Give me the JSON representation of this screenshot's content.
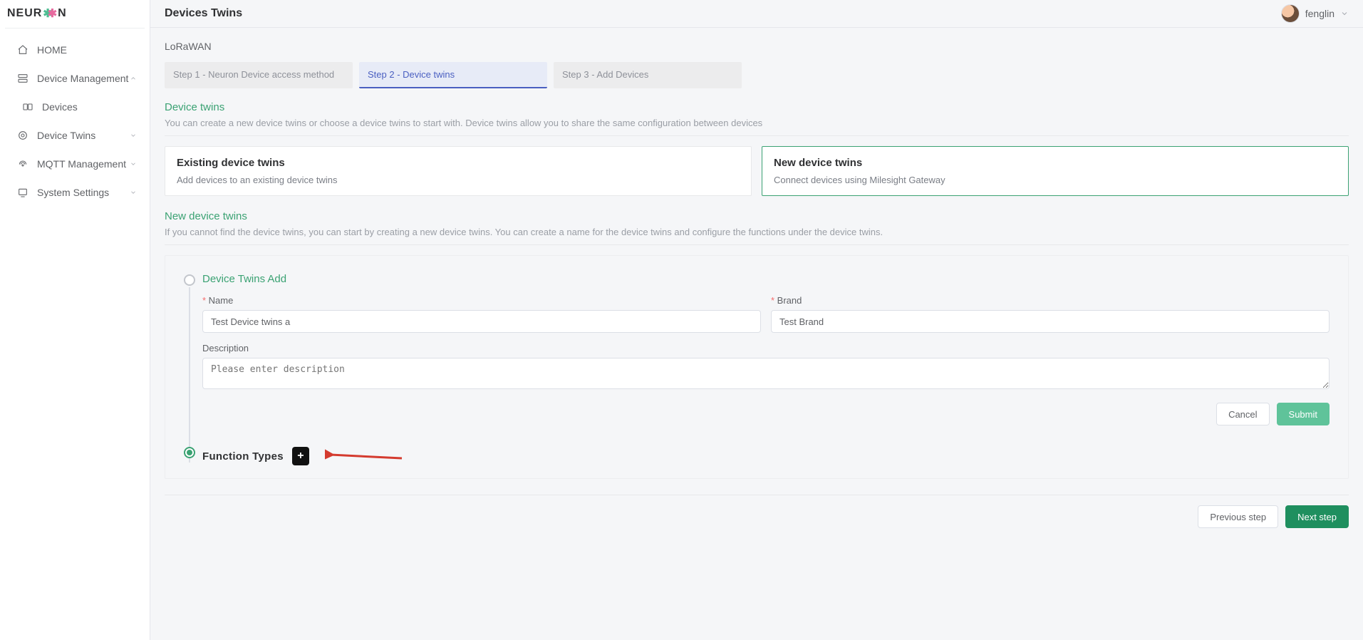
{
  "logo": {
    "text_before": "NEUR",
    "text_after": "N"
  },
  "nav": {
    "items": [
      {
        "label": "HOME"
      },
      {
        "label": "Device Management"
      },
      {
        "label": "Devices"
      },
      {
        "label": "Device Twins"
      },
      {
        "label": "MQTT Management"
      },
      {
        "label": "System Settings"
      }
    ]
  },
  "header": {
    "title": "Devices Twins",
    "user": "fenglin"
  },
  "crumb": "LoRaWAN",
  "steps": [
    {
      "label": "Step 1 - Neuron Device access method"
    },
    {
      "label": "Step 2 - Device twins"
    },
    {
      "label": "Step 3 - Add Devices"
    }
  ],
  "section1": {
    "heading": "Device twins",
    "desc": "You can create a new device twins or choose a device twins to start with. Device twins allow you to share the same configuration between devices"
  },
  "cards": {
    "existing": {
      "title": "Existing device twins",
      "desc": "Add devices to an existing device twins"
    },
    "new": {
      "title": "New device twins",
      "desc": "Connect devices using Milesight Gateway"
    }
  },
  "section2": {
    "heading": "New device twins",
    "desc": "If you cannot find the device twins, you can start by creating a new device twins. You can create a name for the device twins and configure the functions under the device twins."
  },
  "form": {
    "step_title": "Device Twins Add",
    "name_label": "Name",
    "name_value": "Test Device twins a",
    "brand_label": "Brand",
    "brand_value": "Test Brand",
    "desc_label": "Description",
    "desc_placeholder": "Please enter description",
    "cancel": "Cancel",
    "submit": "Submit"
  },
  "function_types": {
    "title": "Function Types"
  },
  "footer": {
    "prev": "Previous step",
    "next": "Next step"
  }
}
